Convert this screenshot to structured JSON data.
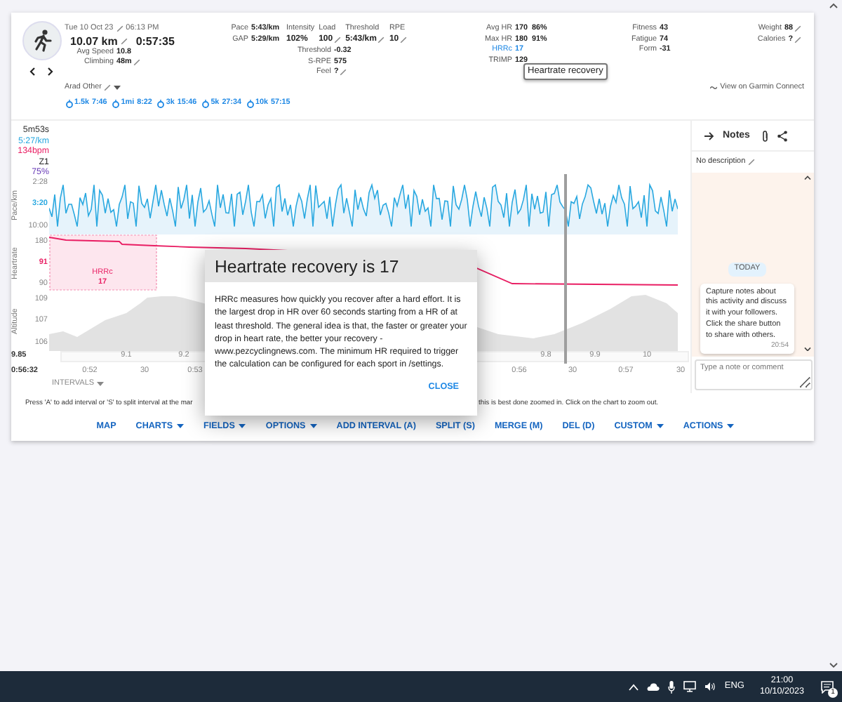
{
  "activity": {
    "date": "Tue 10 Oct 23",
    "date_editable": true,
    "time": "06:13 PM",
    "distance": "10.07 km",
    "distance_editable": true,
    "duration": "0:57:35",
    "stats": [
      {
        "label": "Avg Speed",
        "value": "10.8",
        "editable": false
      },
      {
        "label": "Climbing",
        "value": "48m",
        "editable": true
      }
    ]
  },
  "pace_stats": [
    {
      "label": "Pace",
      "value": "5:43/km"
    },
    {
      "label": "GAP",
      "value": "5:29/km"
    }
  ],
  "load_columns": [
    {
      "label": "Intensity",
      "value": "102%",
      "editable": false
    },
    {
      "label": "Load",
      "value": "100",
      "editable": true
    },
    {
      "label": "Threshold",
      "value": "5:43/km",
      "editable": true
    },
    {
      "label": "RPE",
      "value": "10",
      "editable": true
    }
  ],
  "load_stats": [
    {
      "label": "Threshold",
      "value": "-0.32",
      "editable": false
    },
    {
      "label": "S-RPE",
      "value": "575",
      "editable": false
    },
    {
      "label": "Feel",
      "value": "?",
      "editable": true
    }
  ],
  "hr_stats": [
    {
      "label": "Avg HR",
      "value": "170",
      "extra": "86%",
      "kind": "plain"
    },
    {
      "label": "Max HR",
      "value": "180",
      "extra": "91%",
      "kind": "plain"
    },
    {
      "label": "HRRc",
      "value": "17",
      "kind": "link"
    },
    {
      "label": "TRIMP",
      "value": "129",
      "kind": "plain"
    }
  ],
  "fitness_stats": [
    {
      "label": "Fitness",
      "value": "43"
    },
    {
      "label": "Fatigue",
      "value": "74"
    },
    {
      "label": "Form",
      "value": "-31"
    }
  ],
  "body_stats": [
    {
      "label": "Weight",
      "value": "88",
      "editable": true
    },
    {
      "label": "Calories",
      "value": "?",
      "editable": true
    }
  ],
  "tooltip": "Heartrate recovery",
  "activity_type": "Arad Other",
  "garmin_link": "View on Garmin Connect",
  "splits": [
    {
      "label": "1.5k",
      "time": "7:46"
    },
    {
      "label": "1mi",
      "time": "8:22"
    },
    {
      "label": "3k",
      "time": "15:46"
    },
    {
      "label": "5k",
      "time": "27:34"
    },
    {
      "label": "10k",
      "time": "57:15"
    }
  ],
  "chart": {
    "readout": [
      {
        "text": "5m53s",
        "color": "#333333"
      },
      {
        "text": "5:27/km",
        "color": "#29a8e0"
      },
      {
        "text": "134bpm",
        "color": "#e91e63"
      },
      {
        "text": "Z1",
        "color": "#222222"
      },
      {
        "text": "75%",
        "color": "#673ab7"
      }
    ],
    "panels": [
      {
        "kind": "pace",
        "title": "Pace/km",
        "color": "#29a8e0",
        "ticks": [
          {
            "text": "2:28",
            "current": false
          },
          {
            "text": "3:20",
            "current": true
          },
          {
            "text": "10:00",
            "current": false
          }
        ]
      },
      {
        "kind": "heartrate",
        "title": "Heartrate",
        "color": "#e91e63",
        "ticks": [
          {
            "text": "180",
            "current": false
          },
          {
            "text": "91",
            "current": true
          },
          {
            "text": "90",
            "current": false
          }
        ],
        "hrrc_label": "HRRc",
        "hrrc_value": "17"
      },
      {
        "kind": "altitude",
        "title": "Altitude",
        "color": "#e2e2e2",
        "ticks": [
          {
            "text": "109",
            "current": false
          },
          {
            "text": "107",
            "current": false
          },
          {
            "text": "106",
            "current": false
          }
        ]
      }
    ],
    "distance_marker": "9.85",
    "distance_ticks": [
      "9.1",
      "9.2",
      "9.8",
      "9.9",
      "10"
    ],
    "time_marker": "0:56:32",
    "time_ticks": [
      "0:52",
      "30",
      "0:53",
      "0:56",
      "30",
      "0:57",
      "30"
    ],
    "intervals_button": "INTERVALS"
  },
  "notes": {
    "title": "Notes",
    "description": "No description",
    "day_label": "TODAY",
    "message": "Capture notes about this activity and discuss it with your followers. Click the share button to share with others.",
    "message_time": "20:54",
    "placeholder": "Type a note or comment"
  },
  "hint": [
    "Press 'A' to add interval or 'S' to split interval at the mar",
    "this is best done zoomed in. Click on the chart to zoom out."
  ],
  "toolbar": [
    {
      "label": "MAP",
      "dropdown": false
    },
    {
      "label": "CHARTS",
      "dropdown": true
    },
    {
      "label": "FIELDS",
      "dropdown": true
    },
    {
      "label": "OPTIONS",
      "dropdown": true
    },
    {
      "label": "ADD INTERVAL (A)",
      "dropdown": false
    },
    {
      "label": "SPLIT (S)",
      "dropdown": false
    },
    {
      "label": "MERGE (M)",
      "dropdown": false
    },
    {
      "label": "DEL (D)",
      "dropdown": false
    },
    {
      "label": "CUSTOM",
      "dropdown": true
    },
    {
      "label": "ACTIONS",
      "dropdown": true
    }
  ],
  "modal": {
    "title": "Heartrate recovery is 17",
    "text_before": "HRRc measures how quickly you recover after a hard effort. It is the largest drop in HR over 60 seconds starting from a HR of at least threshold. The general idea is that, the faster or greater your drop in heart rate, the better your recovery - ",
    "link": "www.pezcyclingnews.com",
    "text_after": ". The minimum HR required to trigger the calculation can be configured for each sport in /settings.",
    "close": "CLOSE"
  },
  "taskbar": {
    "language": "ENG",
    "time": "21:00",
    "date": "10/10/2023",
    "notification_count": "1"
  }
}
